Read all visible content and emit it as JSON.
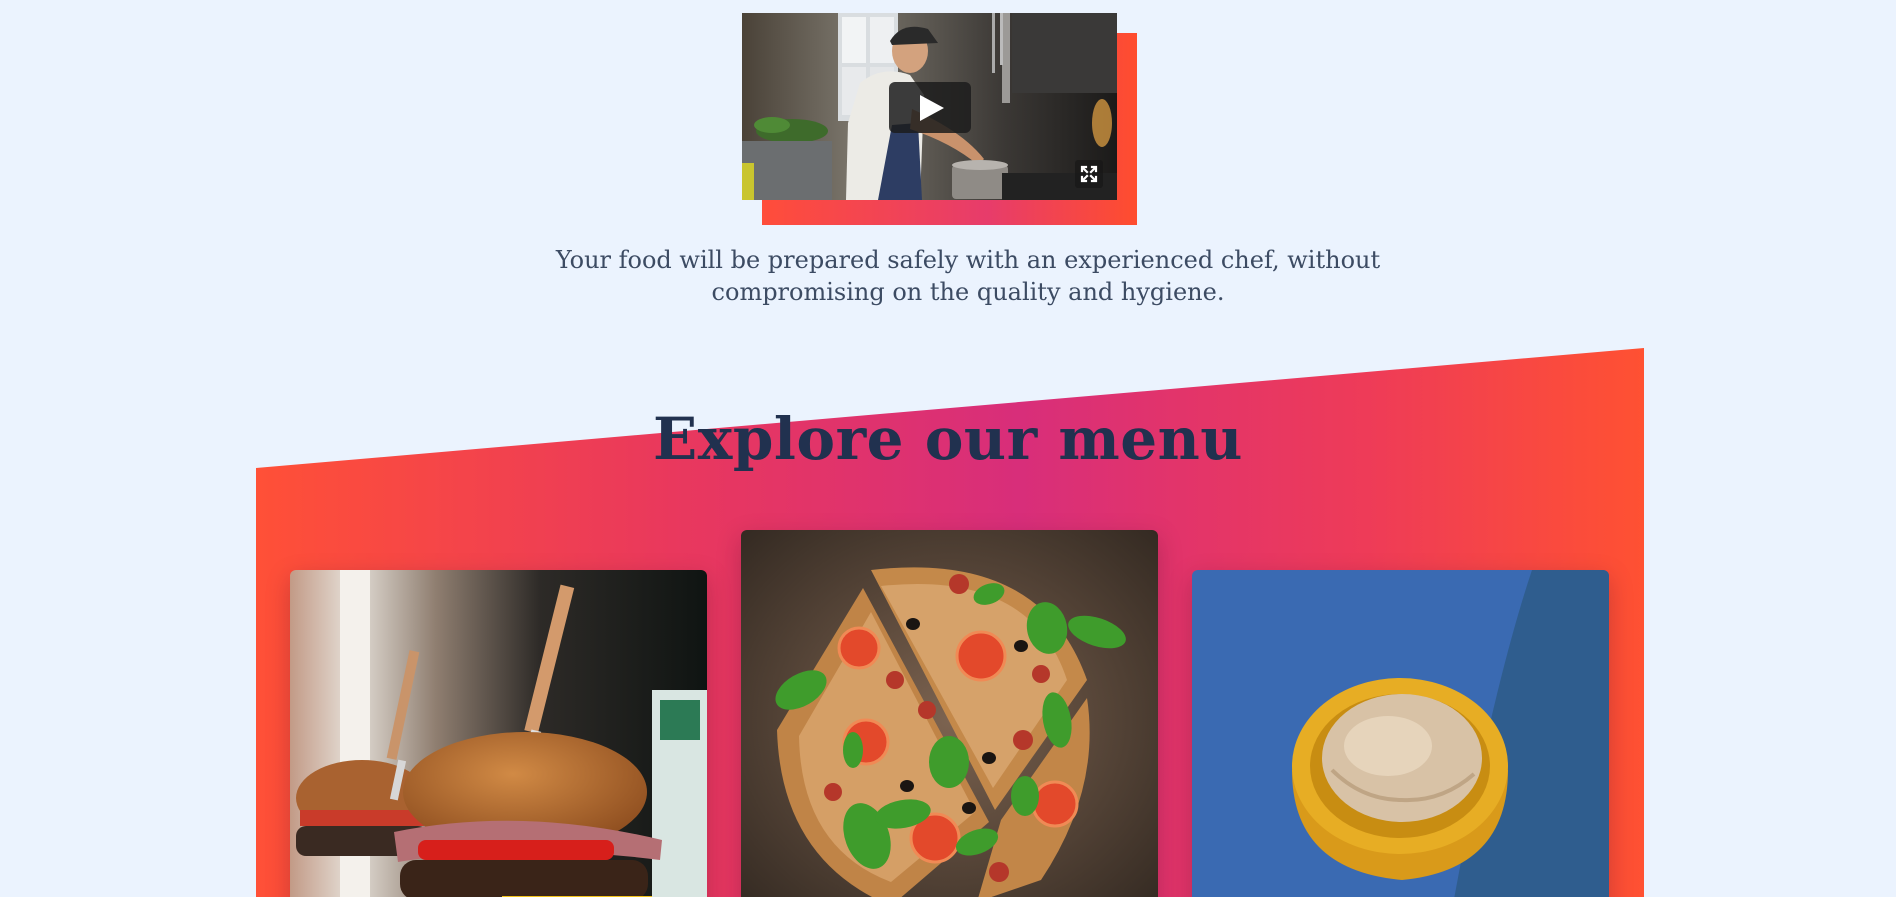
{
  "video": {
    "play_label": "Play video",
    "fullscreen_label": "Fullscreen"
  },
  "intro": {
    "description": "Your food will be prepared safely with an experienced chef, without compromising on the quality and hygiene."
  },
  "menu": {
    "title": "Explore our menu",
    "items": [
      {
        "image": "burger-photo"
      },
      {
        "image": "pizza-photo"
      },
      {
        "image": "ice-cream-photo"
      }
    ]
  },
  "colors": {
    "background": "#EBF3FE",
    "heading": "#21314F",
    "body_text": "#3C4B63",
    "gradient_orange": "#FF5037",
    "gradient_magenta": "#D82E7A"
  }
}
